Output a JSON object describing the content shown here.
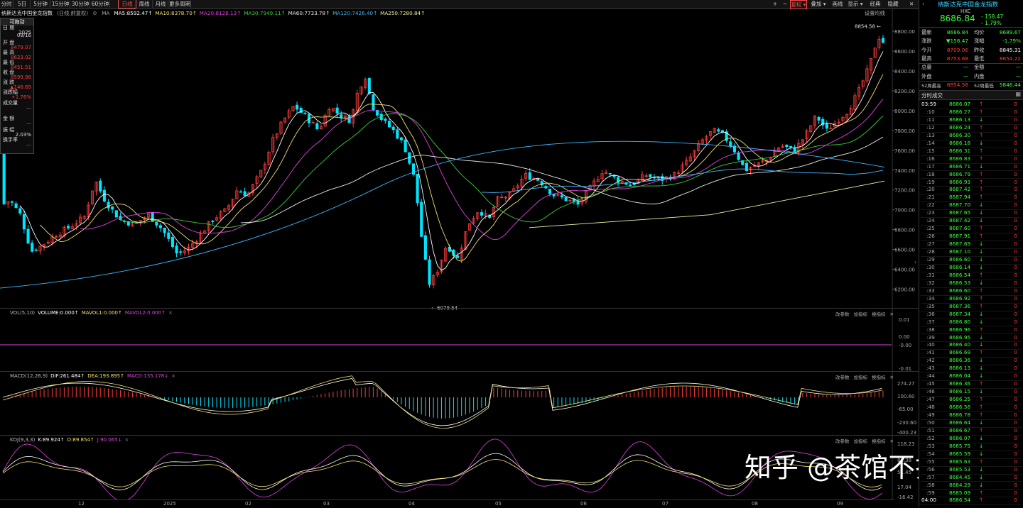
{
  "periods": [
    "分时",
    "5日",
    "5分钟",
    "15分钟",
    "30分钟",
    "60分钟",
    "日线",
    "周线",
    "月线",
    "更多周期"
  ],
  "active_period": "日线",
  "toolbar_right": {
    "plus": "+",
    "minus": "−",
    "fuquan": "复权",
    "overlay": "叠加",
    "draw": "画线",
    "display": "显示",
    "classic": "经典",
    "hide": "隐藏"
  },
  "title": "纳斯达克中国金龙指数",
  "subtitle": "(日线,前复权)",
  "ma_label": "MA",
  "ma": [
    {
      "text": "MA5:8592.47",
      "color": "#ffffff"
    },
    {
      "text": "MA10:8378.70",
      "color": "#f2e26c"
    },
    {
      "text": "MA20:8128.13",
      "color": "#e040e0"
    },
    {
      "text": "MA30:7949.11",
      "color": "#38d038"
    },
    {
      "text": "MA60:7733.78",
      "color": "#e8e8e8"
    },
    {
      "text": "MA120:7426.40",
      "color": "#3fb7ff"
    },
    {
      "text": "MA250:7280.84",
      "color": "#f2f2a0"
    }
  ],
  "settings_label": "设置均线",
  "infobox": {
    "header": "可拖动",
    "date_label": "日  期",
    "year": "2025",
    "date": "09/16",
    "open_label": "开  盘",
    "open": "8479.07",
    "high_label": "最  高",
    "high": "8623.02",
    "low_label": "最  低",
    "low": "8451.51",
    "close_label": "收  盘",
    "close": "8599.98",
    "chg_label": "涨  跌",
    "chg": "▲148.69",
    "pct_label": "涨跌幅",
    "pct": "+1.76%",
    "vol_label": "成交量",
    "vol": "—",
    "amt_label": "金  额",
    "amt": "—",
    "amp_label": "振  幅",
    "amp": "2.03%",
    "turn_label": "换手率",
    "turn": "—"
  },
  "price_axis": [
    "8800.00",
    "8600.00",
    "8400.00",
    "8200.00",
    "8000.00",
    "7800.00",
    "7600.00",
    "7400.00",
    "7200.00",
    "7000.00",
    "6800.00",
    "6600.00",
    "6400.00",
    "6200.00"
  ],
  "price_axis_range": [
    6110,
    8930
  ],
  "max_annot": "8854.58",
  "min_annot": "6079.54",
  "vol_title": [
    "VOL(5,10)",
    "VOLUME:0.000",
    "MAVOL1:0.000",
    "MAVOL2:0.000"
  ],
  "vol_axis": [
    "0.01",
    "0.00",
    "-0.00",
    "-0.01"
  ],
  "macd_title": [
    "MACD(12,26,9)",
    "DIF:261.484",
    "DEA:193.895",
    "MACD:135.178"
  ],
  "macd_axis": [
    "274.27",
    "100.60",
    "-65.00",
    "-230.60",
    "-400.23"
  ],
  "kdj_title": [
    "KDJ(9,3,3)",
    "K:89.924",
    "D:89.854",
    "J:90.065"
  ],
  "kdj_axis": [
    "118.23",
    "82.38",
    "51.45",
    "17.04",
    "-16.42"
  ],
  "sub_buttons": [
    "改参数",
    "加指标",
    "换指标"
  ],
  "x_labels": [
    "12",
    "2025",
    "02",
    "03",
    "04",
    "05",
    "06",
    "07",
    "08",
    "09"
  ],
  "watermark": "知乎 @茶馆不打烊",
  "quote": {
    "name": "纳斯达克中国金龙指数",
    "code": "HXC",
    "price": "8686.84",
    "chg": "- 158.47",
    "pct": "- 1.79%",
    "rows": [
      [
        "最新",
        "8686.84",
        "均价",
        "8689.67"
      ],
      [
        "涨跌",
        "▼158.47",
        "涨幅",
        "-1.79%"
      ],
      [
        "今开",
        "8709.06",
        "昨收",
        "8845.31"
      ],
      [
        "最高",
        "8753.68",
        "最低",
        "8654.22"
      ],
      [
        "总量",
        "—",
        "金额",
        "—"
      ],
      [
        "外盘",
        "—",
        "内盘",
        "—"
      ],
      [
        "52周最高",
        "8854.58",
        "52周最低",
        "5846.44"
      ]
    ],
    "ticks_title": "分时成交"
  },
  "ticks": [
    [
      "03:59",
      "8686.07",
      "↑",
      "0"
    ],
    [
      ":10",
      "8686.27",
      "↑",
      "0"
    ],
    [
      ":11",
      "8686.13",
      "↓",
      "0"
    ],
    [
      ":12",
      "8686.24",
      "↑",
      "0"
    ],
    [
      ":13",
      "8686.30",
      "↑",
      "0"
    ],
    [
      ":14",
      "8686.18",
      "↓",
      "0"
    ],
    [
      ":15",
      "8686.31",
      "↑",
      "0"
    ],
    [
      ":16",
      "8686.83",
      "↑",
      "0"
    ],
    [
      ":17",
      "8686.71",
      "↓",
      "0"
    ],
    [
      ":18",
      "8686.79",
      "↑",
      "0"
    ],
    [
      ":19",
      "8686.93",
      "↑",
      "0"
    ],
    [
      ":20",
      "8687.42",
      "↑",
      "0"
    ],
    [
      ":21",
      "8687.94",
      "↑",
      "0"
    ],
    [
      ":22",
      "8687.70",
      "↓",
      "0"
    ],
    [
      ":23",
      "8687.65",
      "↓",
      "0"
    ],
    [
      ":24",
      "8687.42",
      "↓",
      "0"
    ],
    [
      ":25",
      "8687.60",
      "↑",
      "0"
    ],
    [
      ":26",
      "8687.91",
      "↑",
      "0"
    ],
    [
      ":27",
      "8687.69",
      "↓",
      "0"
    ],
    [
      ":28",
      "8687.10",
      "↓",
      "0"
    ],
    [
      ":29",
      "8686.60",
      "↓",
      "0"
    ],
    [
      ":30",
      "8686.14",
      "↓",
      "0"
    ],
    [
      ":31",
      "8686.54",
      "↑",
      "0"
    ],
    [
      ":32",
      "8686.53",
      "↓",
      "0"
    ],
    [
      ":33",
      "8686.60",
      "↑",
      "0"
    ],
    [
      ":34",
      "8686.92",
      "↑",
      "0"
    ],
    [
      ":35",
      "8687.36",
      "↑",
      "0"
    ],
    [
      ":36",
      "8687.34",
      "↓",
      "0"
    ],
    [
      ":37",
      "8686.80",
      "↓",
      "0"
    ],
    [
      ":38",
      "8686.96",
      "↑",
      "0"
    ],
    [
      ":39",
      "8686.95",
      "↓",
      "0"
    ],
    [
      ":40",
      "8686.40",
      "↓",
      "0"
    ],
    [
      ":41",
      "8686.69",
      "↑",
      "0"
    ],
    [
      ":42",
      "8686.36",
      "↓",
      "0"
    ],
    [
      ":43",
      "8686.13",
      "↓",
      "0"
    ],
    [
      ":44",
      "8686.04",
      "↓",
      "0"
    ],
    [
      ":45",
      "8686.36",
      "↑",
      "0"
    ],
    [
      ":46",
      "8686.15",
      "↓",
      "0"
    ],
    [
      ":47",
      "8686.25",
      "↑",
      "0"
    ],
    [
      ":48",
      "8686.56",
      "↑",
      "0"
    ],
    [
      ":49",
      "8686.78",
      "↑",
      "0"
    ],
    [
      ":50",
      "8686.64",
      "↓",
      "0"
    ],
    [
      ":51",
      "8686.67",
      "↑",
      "0"
    ],
    [
      ":52",
      "8686.07",
      "↓",
      "0"
    ],
    [
      ":53",
      "8685.75",
      "↓",
      "0"
    ],
    [
      ":54",
      "8685.59",
      "↓",
      "0"
    ],
    [
      ":55",
      "8685.63",
      "↑",
      "0"
    ],
    [
      ":56",
      "8685.53",
      "↓",
      "0"
    ],
    [
      ":57",
      "8684.45",
      "↓",
      "0"
    ],
    [
      ":58",
      "8684.29",
      "↓",
      "0"
    ],
    [
      ":59",
      "8685.09",
      "↑",
      "0"
    ],
    [
      "04:00",
      "8686.54",
      "↑",
      "0"
    ]
  ],
  "colors": {
    "up": "#ff3b3b",
    "down": "#00e5ff",
    "green": "#3cff3c",
    "yellow": "#f2e26c",
    "magenta": "#e040e0"
  }
}
